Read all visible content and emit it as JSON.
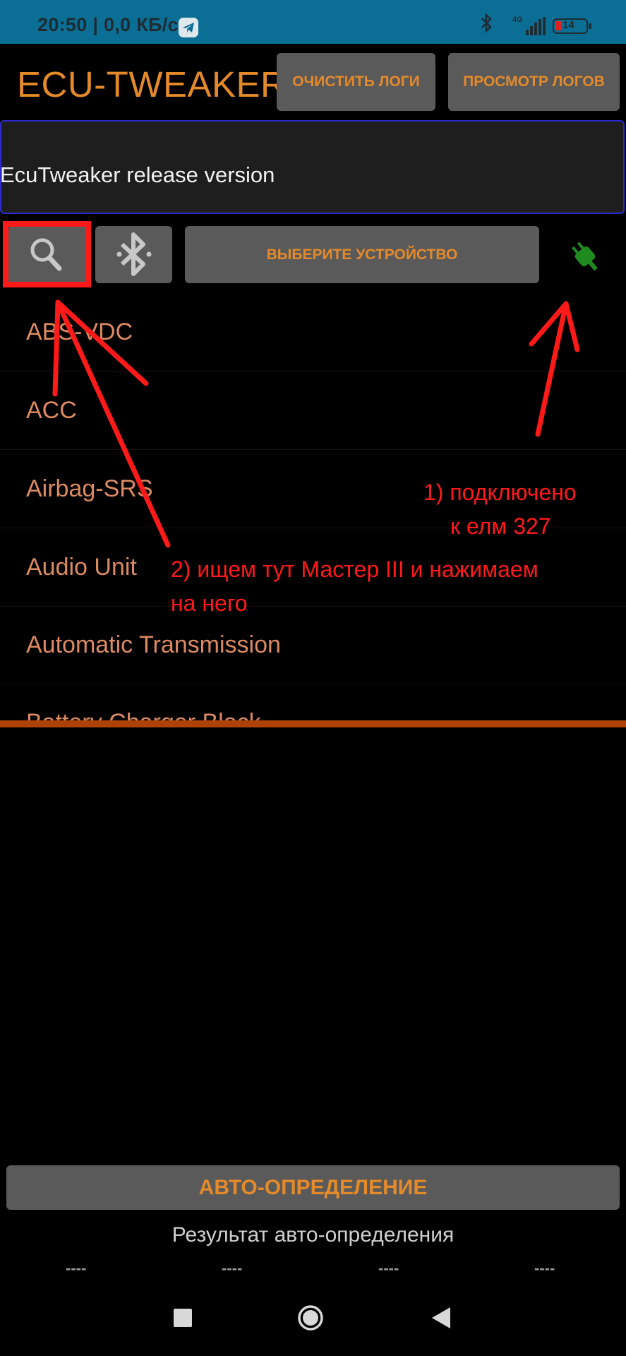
{
  "status_bar": {
    "time_speed": "20:50 | 0,0 КБ/с",
    "network": "4G",
    "battery": "14"
  },
  "header": {
    "title": "ECU-TWEAKER",
    "clear_logs_label": "ОЧИСТИТЬ ЛОГИ",
    "view_logs_label": "ПРОСМОТР ЛОГОВ"
  },
  "log_panel": {
    "text": "EcuTweaker release version"
  },
  "toolbar": {
    "select_device_label": "ВЫБЕРИТЕ УСТРОЙСТВО",
    "connection_status_icon": "plug-connected-icon"
  },
  "ecu_list": {
    "items": [
      "ABS-VDC",
      "ACC",
      "Airbag-SRS",
      "Audio Unit",
      "Automatic Transmission",
      "Battery Charger Block"
    ]
  },
  "bottom": {
    "auto_detect_label": "АВТО-ОПРЕДЕЛЕНИЕ",
    "auto_detect_result_label": "Результат авто-определения",
    "results": [
      "----",
      "----",
      "----",
      "----"
    ]
  },
  "annotations": {
    "note1_line1": "1) подключено",
    "note1_line2": "к елм 327",
    "note2_line1": "2) ищем тут Мастер III и нажимаем",
    "note2_line2": "на него"
  },
  "colors": {
    "accent": "#e48a2a",
    "status_bar": "#0b6f95",
    "button": "#5a5a5a",
    "list_text": "#dc8a62",
    "annotation": "#ff1a1a",
    "connected": "#1f8a1f"
  }
}
